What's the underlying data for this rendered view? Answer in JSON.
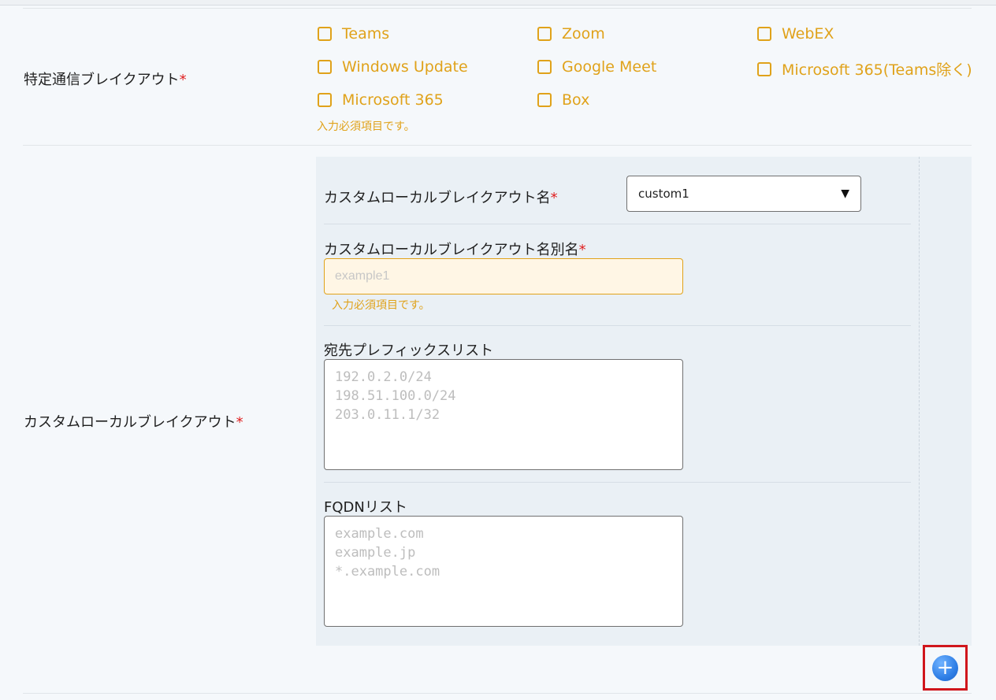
{
  "breakout": {
    "label": "特定通信ブレイクアウト",
    "required_mark": "*",
    "options": [
      {
        "label": "Teams",
        "checked": false
      },
      {
        "label": "Zoom",
        "checked": false
      },
      {
        "label": "WebEX",
        "checked": false
      },
      {
        "label": "Windows Update",
        "checked": false
      },
      {
        "label": "Google Meet",
        "checked": false
      },
      {
        "label": "Microsoft 365(Teams除く)",
        "checked": false
      },
      {
        "label": "Microsoft 365",
        "checked": false
      },
      {
        "label": "Box",
        "checked": false
      }
    ],
    "error": "入力必須項目です。"
  },
  "custom": {
    "label": "カスタムローカルブレイクアウト",
    "required_mark": "*",
    "name_label": "カスタムローカルブレイクアウト名",
    "name_value": "custom1",
    "alias_label": "カスタムローカルブレイクアウト名別名",
    "alias_placeholder": "example1",
    "alias_error": "入力必須項目です。",
    "prefix_label": "宛先プレフィックスリスト",
    "prefix_placeholder": "192.0.2.0/24\n198.51.100.0/24\n203.0.11.1/32",
    "fqdn_label": "FQDNリスト",
    "fqdn_placeholder": "example.com\nexample.jp\n*.example.com",
    "add_icon": "+"
  },
  "colors": {
    "accent": "#e0a21a",
    "required": "#e02020",
    "add_button": "#2f7fe6",
    "highlight_border": "#d0161c"
  }
}
